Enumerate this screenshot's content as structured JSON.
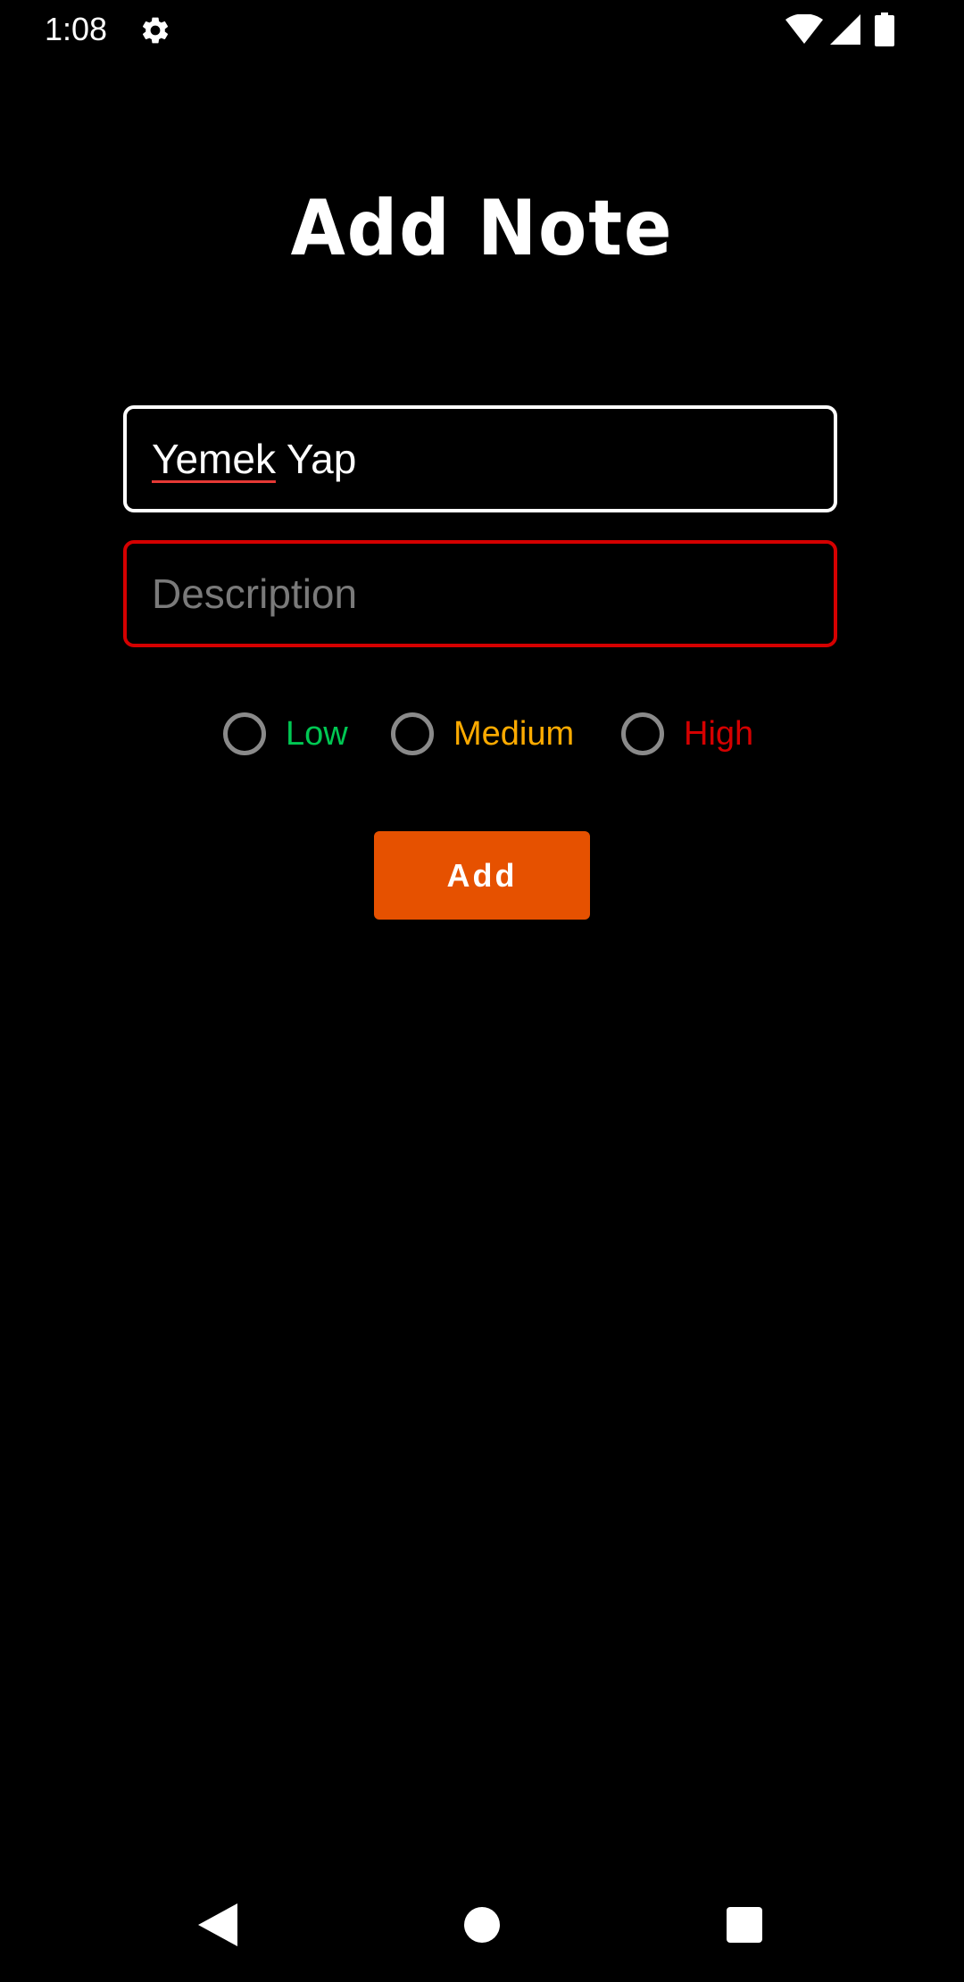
{
  "status_bar": {
    "time": "1:08",
    "icons": [
      "gear-icon",
      "wifi-icon",
      "signal-icon",
      "battery-icon"
    ]
  },
  "page": {
    "title": "Add Note"
  },
  "form": {
    "title_value": "Yemek",
    "title_value_rest": " Yap",
    "title_border_color": "#ffffff",
    "description_placeholder": "Description",
    "description_border_color": "#d50000"
  },
  "priority": {
    "options": [
      {
        "label": "Low",
        "color": "#00c853",
        "selected": false
      },
      {
        "label": "Medium",
        "color": "#ffab00",
        "selected": false
      },
      {
        "label": "High",
        "color": "#d50000",
        "selected": false
      }
    ]
  },
  "actions": {
    "add_label": "Add",
    "add_color": "#e65100"
  },
  "nav_bar": {
    "icons": [
      "back-icon",
      "home-icon",
      "recents-icon"
    ]
  }
}
